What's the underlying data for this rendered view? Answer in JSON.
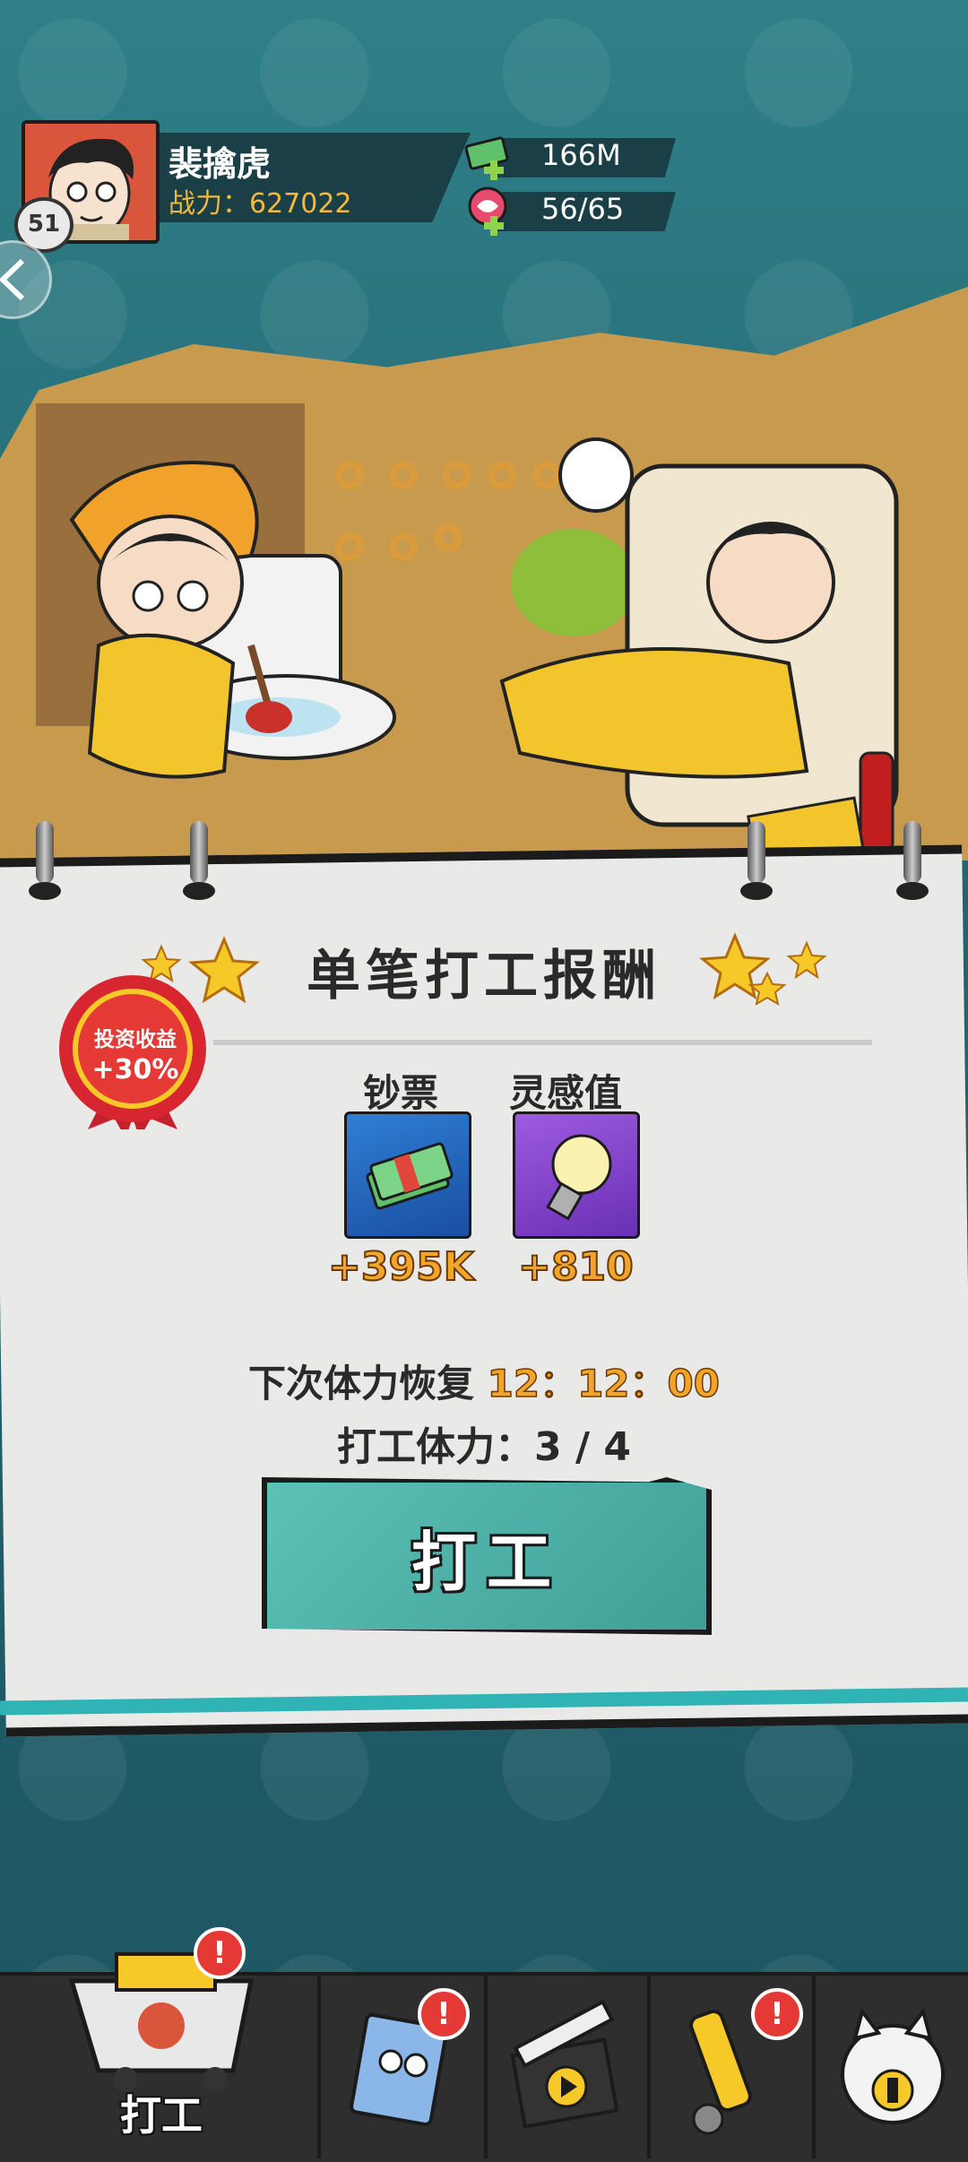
{
  "player": {
    "name": "裴擒虎",
    "power_label": "战力：",
    "power_value": "627022",
    "level": "51"
  },
  "resources": {
    "cash": "166M",
    "stamina": "56/65"
  },
  "rewards": {
    "title": "单笔打工报酬",
    "investment_badge_line1": "投资收益",
    "investment_badge_line2": "+30%",
    "items": [
      {
        "label": "钞票",
        "amount": "+395K",
        "icon": "cash-stack-icon"
      },
      {
        "label": "灵感值",
        "amount": "+810",
        "icon": "lightbulb-icon"
      }
    ]
  },
  "status": {
    "recover_label": "下次体力恢复",
    "recover_time": "12：12：00",
    "stamina_label": "打工体力：3 / 4"
  },
  "work_button_label": "打工",
  "bottom_nav": {
    "active_tab_label": "打工",
    "alert_mark": "!"
  },
  "colors": {
    "accent_teal": "#3f9f96",
    "gold": "#f3a52a",
    "alert_red": "#e53935"
  }
}
